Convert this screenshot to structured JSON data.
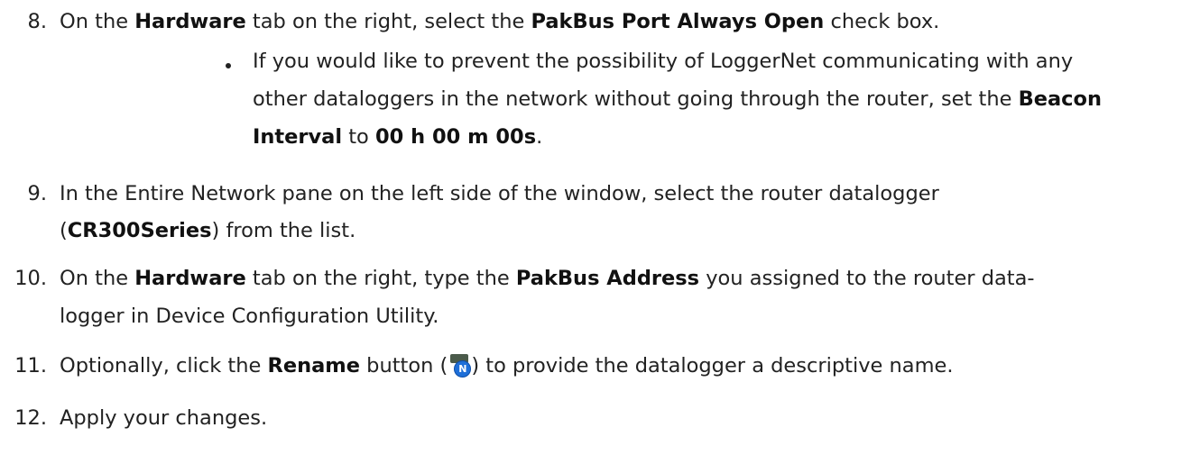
{
  "steps": [
    {
      "number": "8.",
      "lines": [
        [
          {
            "t": "On the "
          },
          {
            "t": "Hardware",
            "b": true
          },
          {
            "t": " tab on the right, select the "
          },
          {
            "t": "PakBus Port Always Open",
            "b": true
          },
          {
            "t": " check box."
          }
        ]
      ],
      "sub_bullet": {
        "lines": [
          [
            {
              "t": "If you would like to prevent the possibility of LoggerNet communicating with any"
            }
          ],
          [
            {
              "t": "other dataloggers in the network without going through the router, set the "
            },
            {
              "t": "Beacon",
              "b": true
            }
          ],
          [
            {
              "t": "Interval",
              "b": true
            },
            {
              "t": " to "
            },
            {
              "t": "00 h 00 m 00s",
              "b": true
            },
            {
              "t": "."
            }
          ]
        ]
      }
    },
    {
      "number": "9.",
      "lines": [
        [
          {
            "t": "In the Entire Network pane on the left side of the window, select the router datalogger"
          }
        ],
        [
          {
            "t": "("
          },
          {
            "t": "CR300Series",
            "b": true
          },
          {
            "t": ") from the list."
          }
        ]
      ]
    },
    {
      "number": "10.",
      "lines": [
        [
          {
            "t": "On the "
          },
          {
            "t": "Hardware",
            "b": true
          },
          {
            "t": " tab on the right, type the "
          },
          {
            "t": "PakBus Address",
            "b": true
          },
          {
            "t": " you assigned to the router data-"
          }
        ],
        [
          {
            "t": "logger in Device Configuration Utility."
          }
        ]
      ]
    },
    {
      "number": "11.",
      "lines": [
        [
          {
            "t": "Optionally, click the "
          },
          {
            "t": "Rename",
            "b": true
          },
          {
            "t": " button ("
          },
          {
            "icon": "rename-button-icon"
          },
          {
            "t": ") to provide the datalogger a descriptive name."
          }
        ]
      ]
    },
    {
      "number": "12.",
      "lines": [
        [
          {
            "t": "Apply your changes."
          }
        ]
      ]
    }
  ],
  "icons": {
    "rename_badge_letter": "N",
    "rename_badge_color": "#1e6fd8"
  }
}
